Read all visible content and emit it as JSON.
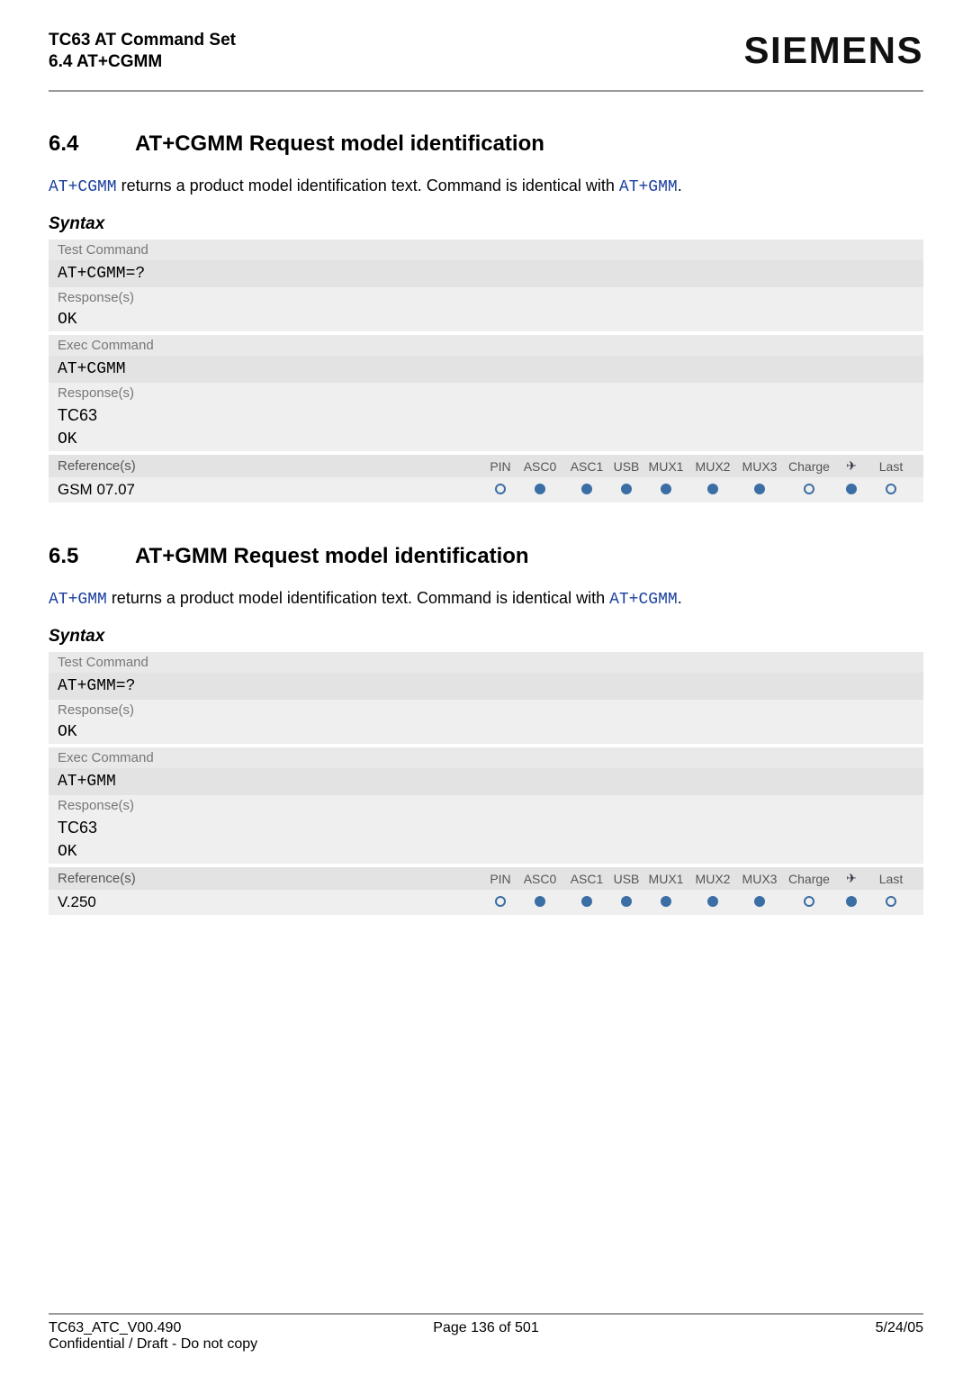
{
  "header": {
    "doc_title": "TC63 AT Command Set",
    "doc_sub": "6.4 AT+CGMM",
    "logo": "SIEMENS"
  },
  "sections": [
    {
      "num": "6.4",
      "title": "AT+CGMM   Request model identification",
      "intro_pre": "AT+CGMM",
      "intro_mid": " returns a product model identification text. Command is identical with ",
      "intro_link": "AT+GMM",
      "intro_post": ".",
      "syntax_label": "Syntax",
      "test_cmd_label": "Test Command",
      "test_cmd": "AT+CGMM=?",
      "resp_label_1": "Response(s)",
      "ok_1": "OK",
      "exec_label": "Exec Command",
      "exec_cmd": "AT+CGMM",
      "resp_label_2": "Response(s)",
      "tc_line": "TC63",
      "ok_2": "OK",
      "ref_label": "Reference(s)",
      "ref_headers": [
        "PIN",
        "ASC0",
        "ASC1",
        "USB",
        "MUX1",
        "MUX2",
        "MUX3",
        "Charge",
        "✈",
        "Last"
      ],
      "ref_value_label": "GSM 07.07",
      "ref_marks": [
        "ring",
        "dot",
        "dot",
        "dot",
        "dot",
        "dot",
        "dot",
        "ring",
        "dot",
        "ring"
      ]
    },
    {
      "num": "6.5",
      "title": "AT+GMM   Request model identification",
      "intro_pre": "AT+GMM",
      "intro_mid": " returns a product model identification text. Command is identical with ",
      "intro_link": "AT+CGMM",
      "intro_post": ".",
      "syntax_label": "Syntax",
      "test_cmd_label": "Test Command",
      "test_cmd": "AT+GMM=?",
      "resp_label_1": "Response(s)",
      "ok_1": "OK",
      "exec_label": "Exec Command",
      "exec_cmd": "AT+GMM",
      "resp_label_2": "Response(s)",
      "tc_line": "TC63",
      "ok_2": "OK",
      "ref_label": "Reference(s)",
      "ref_headers": [
        "PIN",
        "ASC0",
        "ASC1",
        "USB",
        "MUX1",
        "MUX2",
        "MUX3",
        "Charge",
        "✈",
        "Last"
      ],
      "ref_value_label": "V.250",
      "ref_marks": [
        "ring",
        "dot",
        "dot",
        "dot",
        "dot",
        "dot",
        "dot",
        "ring",
        "dot",
        "ring"
      ]
    }
  ],
  "footer": {
    "left_1": "TC63_ATC_V00.490",
    "left_2": "Confidential / Draft - Do not copy",
    "center": "Page 136 of 501",
    "right": "5/24/05"
  }
}
